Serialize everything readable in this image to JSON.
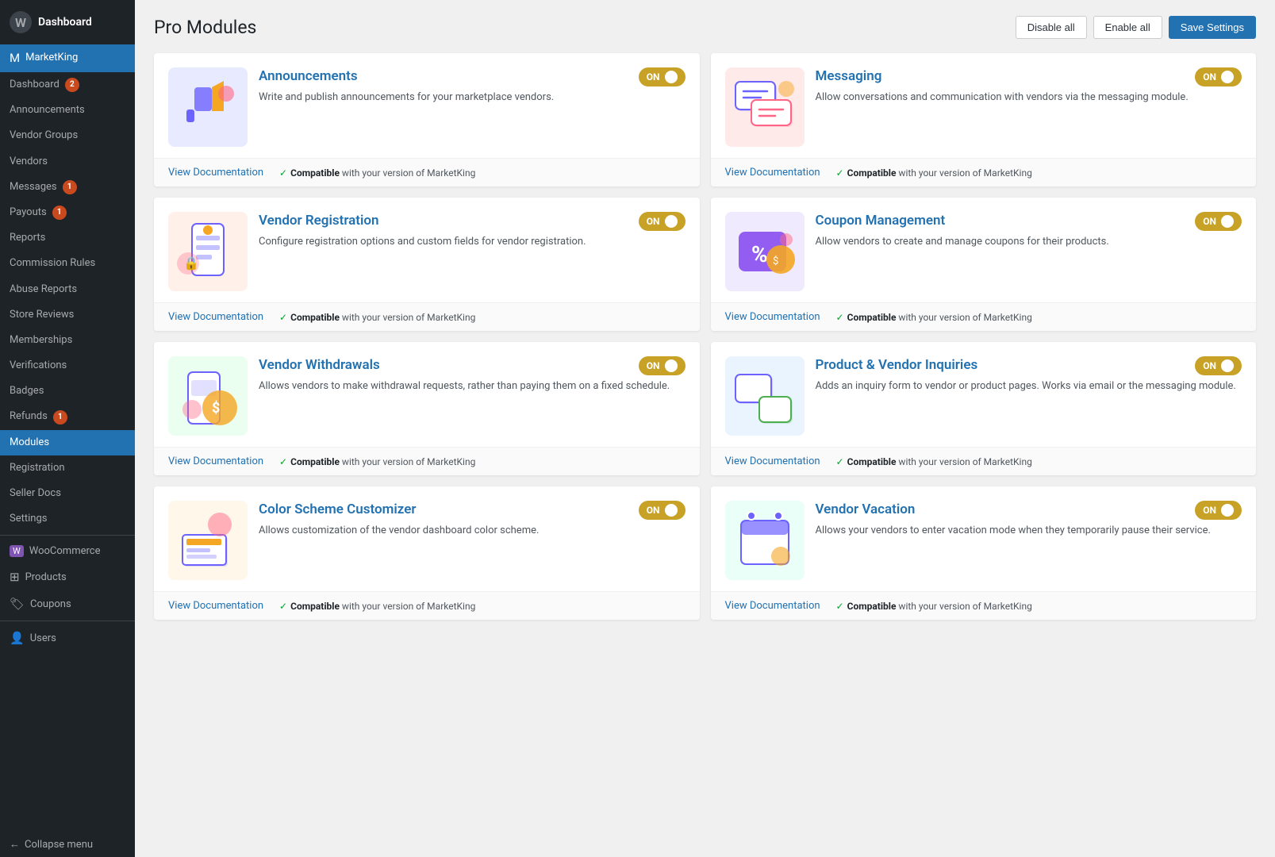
{
  "sidebar": {
    "wp_logo": "W",
    "dashboard_label": "Dashboard",
    "marketking_label": "MarketKing",
    "items": [
      {
        "id": "dashboard",
        "label": "Dashboard",
        "badge": 2,
        "icon": "⊞"
      },
      {
        "id": "announcements",
        "label": "Announcements",
        "badge": null,
        "icon": ""
      },
      {
        "id": "vendor-groups",
        "label": "Vendor Groups",
        "badge": null,
        "icon": ""
      },
      {
        "id": "vendors",
        "label": "Vendors",
        "badge": null,
        "icon": ""
      },
      {
        "id": "messages",
        "label": "Messages",
        "badge": 1,
        "icon": ""
      },
      {
        "id": "payouts",
        "label": "Payouts",
        "badge": 1,
        "icon": ""
      },
      {
        "id": "reports",
        "label": "Reports",
        "badge": null,
        "icon": ""
      },
      {
        "id": "commission-rules",
        "label": "Commission Rules",
        "badge": null,
        "icon": ""
      },
      {
        "id": "abuse-reports",
        "label": "Abuse Reports",
        "badge": null,
        "icon": ""
      },
      {
        "id": "store-reviews",
        "label": "Store Reviews",
        "badge": null,
        "icon": ""
      },
      {
        "id": "memberships",
        "label": "Memberships",
        "badge": null,
        "icon": ""
      },
      {
        "id": "verifications",
        "label": "Verifications",
        "badge": null,
        "icon": ""
      },
      {
        "id": "badges",
        "label": "Badges",
        "badge": null,
        "icon": ""
      },
      {
        "id": "refunds",
        "label": "Refunds",
        "badge": 1,
        "icon": ""
      },
      {
        "id": "modules",
        "label": "Modules",
        "badge": null,
        "icon": ""
      },
      {
        "id": "registration",
        "label": "Registration",
        "badge": null,
        "icon": ""
      },
      {
        "id": "seller-docs",
        "label": "Seller Docs",
        "badge": null,
        "icon": ""
      },
      {
        "id": "settings",
        "label": "Settings",
        "badge": null,
        "icon": ""
      }
    ],
    "woo_items": [
      {
        "id": "woocommerce",
        "label": "WooCommerce",
        "icon": "W"
      },
      {
        "id": "products",
        "label": "Products",
        "icon": "⊞"
      },
      {
        "id": "coupons",
        "label": "Coupons",
        "icon": "🏷"
      }
    ],
    "bottom_items": [
      {
        "id": "users",
        "label": "Users",
        "icon": "👤"
      },
      {
        "id": "collapse",
        "label": "Collapse menu",
        "icon": "←"
      }
    ]
  },
  "page": {
    "title": "Pro Modules",
    "buttons": {
      "disable_all": "Disable all",
      "enable_all": "Enable all",
      "save_settings": "Save Settings"
    }
  },
  "modules": [
    {
      "id": "announcements",
      "title": "Announcements",
      "description": "Write and publish announcements for your marketplace vendors.",
      "toggle": "ON",
      "docs_label": "View Documentation",
      "compatible_text": "Compatible",
      "compatible_suffix": "with your version of MarketKing",
      "illus_color": "#e8eaff"
    },
    {
      "id": "messaging",
      "title": "Messaging",
      "description": "Allow conversations and communication with vendors via the messaging module.",
      "toggle": "ON",
      "docs_label": "View Documentation",
      "compatible_text": "Compatible",
      "compatible_suffix": "with your version of MarketKing",
      "illus_color": "#ffeaea"
    },
    {
      "id": "vendor-registration",
      "title": "Vendor Registration",
      "description": "Configure registration options and custom fields for vendor registration.",
      "toggle": "ON",
      "docs_label": "View Documentation",
      "compatible_text": "Compatible",
      "compatible_suffix": "with your version of MarketKing",
      "illus_color": "#fff0ea"
    },
    {
      "id": "coupon-management",
      "title": "Coupon Management",
      "description": "Allow vendors to create and manage coupons for their products.",
      "toggle": "ON",
      "docs_label": "View Documentation",
      "compatible_text": "Compatible",
      "compatible_suffix": "with your version of MarketKing",
      "illus_color": "#f0eaff"
    },
    {
      "id": "vendor-withdrawals",
      "title": "Vendor Withdrawals",
      "description": "Allows vendors to make withdrawal requests, rather than paying them on a fixed schedule.",
      "toggle": "ON",
      "docs_label": "View Documentation",
      "compatible_text": "Compatible",
      "compatible_suffix": "with your version of MarketKing",
      "illus_color": "#eafff0"
    },
    {
      "id": "product-vendor-inquiries",
      "title": "Product & Vendor Inquiries",
      "description": "Adds an inquiry form to vendor or product pages. Works via email or the messaging module.",
      "toggle": "ON",
      "docs_label": "View Documentation",
      "compatible_text": "Compatible",
      "compatible_suffix": "with your version of MarketKing",
      "illus_color": "#eaf4ff"
    },
    {
      "id": "color-scheme-customizer",
      "title": "Color Scheme Customizer",
      "description": "Allows customization of the vendor dashboard color scheme.",
      "toggle": "ON",
      "docs_label": "View Documentation",
      "compatible_text": "Compatible",
      "compatible_suffix": "with your version of MarketKing",
      "illus_color": "#fff8ea"
    },
    {
      "id": "vendor-vacation",
      "title": "Vendor Vacation",
      "description": "Allows your vendors to enter vacation mode when they temporarily pause their service.",
      "toggle": "ON",
      "docs_label": "View Documentation",
      "compatible_text": "Compatible",
      "compatible_suffix": "with your version of MarketKing",
      "illus_color": "#eafff8"
    }
  ]
}
